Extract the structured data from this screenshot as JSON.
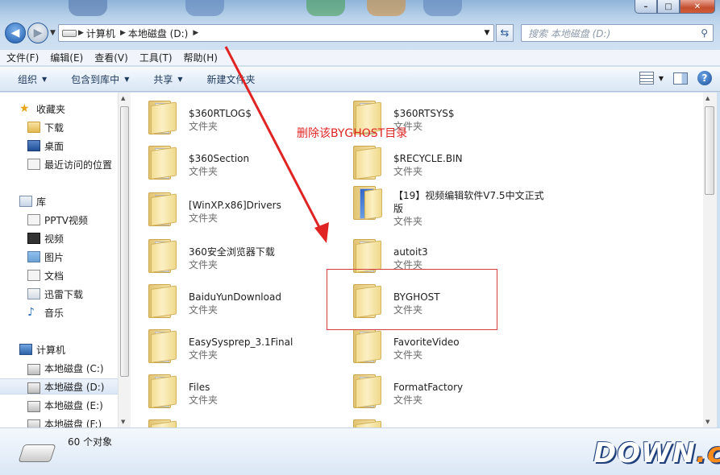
{
  "window": {
    "min": "–",
    "max": "□",
    "close": "✕"
  },
  "address": {
    "seg1": "计算机",
    "seg2": "本地磁盘 (D:)"
  },
  "search": {
    "placeholder": "搜索 本地磁盘 (D:)"
  },
  "menu": [
    "文件(F)",
    "编辑(E)",
    "查看(V)",
    "工具(T)",
    "帮助(H)"
  ],
  "toolbar": {
    "organize": "组织",
    "include": "包含到库中",
    "share": "共享",
    "new_folder": "新建文件夹"
  },
  "nav": {
    "favorites": "收藏夹",
    "download": "下载",
    "desktop": "桌面",
    "recent": "最近访问的位置",
    "libraries": "库",
    "pptv": "PPTV视频",
    "video": "视频",
    "pictures": "图片",
    "docs": "文档",
    "xunlei": "迅雷下载",
    "music": "音乐",
    "computer": "计算机",
    "drive_c": "本地磁盘 (C:)",
    "drive_d": "本地磁盘 (D:)",
    "drive_e": "本地磁盘 (E:)",
    "drive_f": "本地磁盘 (F:)"
  },
  "files": [
    {
      "name": "$360RTLOG$",
      "type": "文件夹"
    },
    {
      "name": "$360RTSYS$",
      "type": "文件夹"
    },
    {
      "name": "$360Section",
      "type": "文件夹"
    },
    {
      "name": "$RECYCLE.BIN",
      "type": "文件夹"
    },
    {
      "name": "[WinXP.x86]Drivers",
      "type": "文件夹"
    },
    {
      "name": "【19】视频编辑软件V7.5中文正式版",
      "type": "文件夹"
    },
    {
      "name": "360安全浏览器下载",
      "type": "文件夹"
    },
    {
      "name": "autoit3",
      "type": "文件夹"
    },
    {
      "name": "BaiduYunDownload",
      "type": "文件夹"
    },
    {
      "name": "BYGHOST",
      "type": "文件夹"
    },
    {
      "name": "EasySysprep_3.1Final",
      "type": "文件夹"
    },
    {
      "name": "FavoriteVideo",
      "type": "文件夹"
    },
    {
      "name": "Files",
      "type": "文件夹"
    },
    {
      "name": "FormatFactory",
      "type": "文件夹"
    }
  ],
  "annotation": "删除该BYGHOST目录",
  "status": {
    "count": "60 个对象"
  },
  "logo": {
    "main": "DOWN",
    "suffix": ".cc"
  },
  "colors": {
    "annotation_red": "#e02424",
    "logo_orange": "#ff8c1a"
  }
}
